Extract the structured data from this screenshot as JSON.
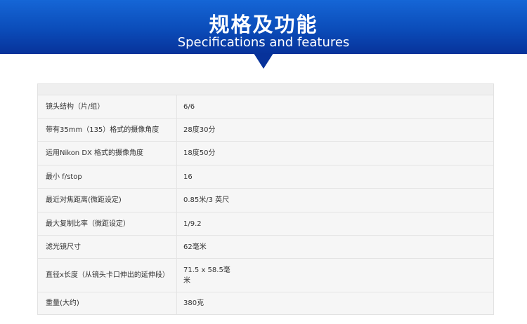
{
  "banner": {
    "title": "规格及功能",
    "subtitle": "Specifications and features",
    "color": "#0b4cb9"
  },
  "specs": {
    "rows": [
      {
        "label": "镜头结构（片/组）",
        "value": "6/6"
      },
      {
        "label": "带有35mm（135）格式的摄像角度",
        "value": "28度30分"
      },
      {
        "label": "运用Nikon DX 格式的摄像角度",
        "value": "18度50分"
      },
      {
        "label": "最小 f/stop",
        "value": "16"
      },
      {
        "label": "最近对焦距离(微距设定)",
        "value": "0.85米/3 英尺"
      },
      {
        "label": "最大复制比率（微距设定）",
        "value": "1/9.2"
      },
      {
        "label": "滤光镜尺寸",
        "value": "62毫米"
      },
      {
        "label": "直径x长度（从镜头卡口伸出的延伸段）",
        "value": "71.5 x 58.5毫米"
      },
      {
        "label": "重量(大约)",
        "value": "380克"
      }
    ]
  }
}
